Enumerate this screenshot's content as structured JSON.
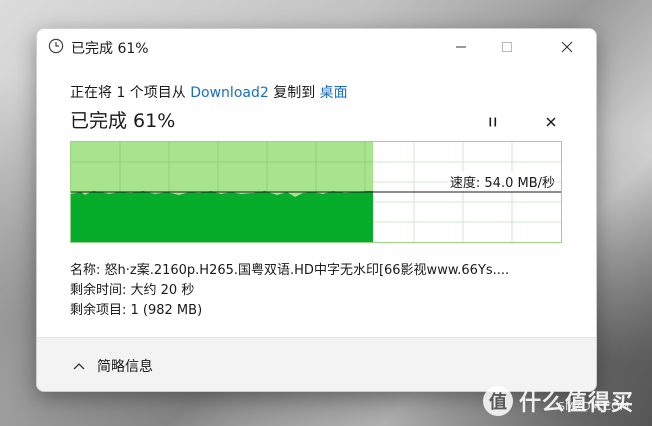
{
  "window": {
    "title": "已完成 61%",
    "icon": "clock-icon"
  },
  "copy": {
    "prefix": "正在将 1 个项目从 ",
    "source": "Download2",
    "middle": " 复制到 ",
    "destination": "桌面"
  },
  "progress": {
    "label": "已完成 61%",
    "percent": 61
  },
  "controls": {
    "pause_icon": "pause-icon",
    "cancel_icon": "close-icon"
  },
  "graph": {
    "speed_label": "速度: 54.0 MB/秒",
    "filled_fraction": 0.61,
    "colors": {
      "fill": "#05ad2a",
      "area": "#a8e38e",
      "grid": "#cfe8c8"
    }
  },
  "info": {
    "name": "名称: 怒h·z案.2160p.H265.国粤双语.HD中字无水印[66影视www.66Ys....",
    "time_remaining": "剩余时间: 大约 20 秒",
    "items_remaining": "剩余项目: 1 (982 MB)"
  },
  "footer": {
    "details_label": "简略信息",
    "chevron_icon": "chevron-up-icon"
  },
  "watermark": {
    "text": "什么值得买",
    "logo": "值",
    "domain": "SMZDM.COM"
  }
}
